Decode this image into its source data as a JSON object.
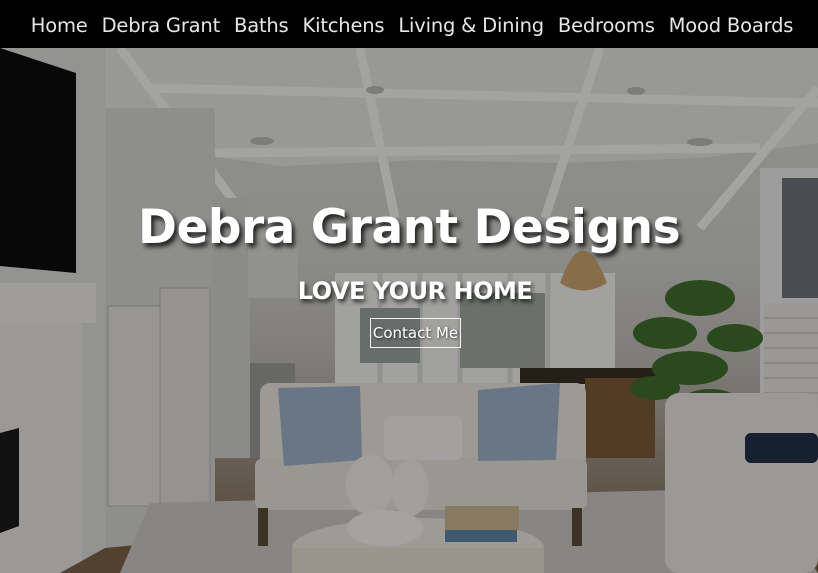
{
  "nav": {
    "items": [
      {
        "label": "Home"
      },
      {
        "label": "Debra Grant"
      },
      {
        "label": "Baths"
      },
      {
        "label": "Kitchens"
      },
      {
        "label": "Living & Dining"
      },
      {
        "label": "Bedrooms"
      },
      {
        "label": "Mood Boards"
      }
    ]
  },
  "hero": {
    "title": "Debra Grant Designs",
    "subtitle": "LOVE YOUR HOME",
    "cta_label": "Contact Me"
  }
}
